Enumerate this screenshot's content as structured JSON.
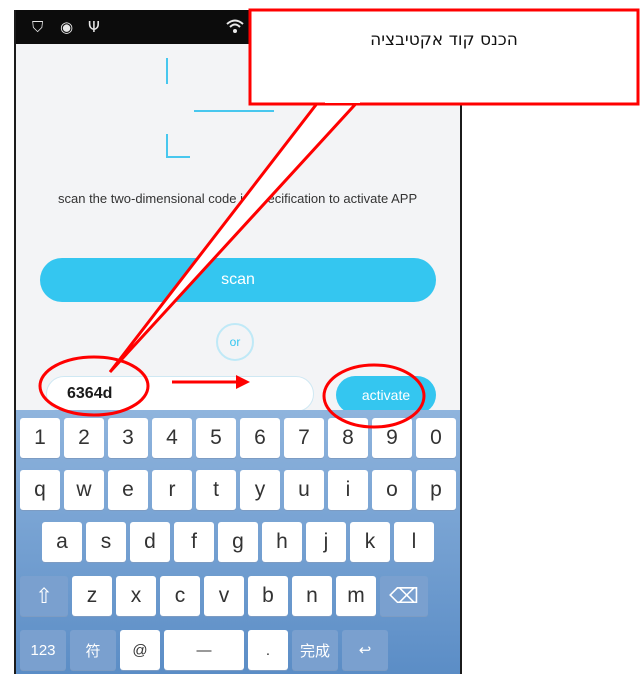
{
  "status_bar": {
    "icons": [
      "shield-icon",
      "circle-icon",
      "usb-icon",
      "wifi-icon"
    ]
  },
  "main": {
    "scan_hint": "scan the two-dimensional code in specification to activate APP",
    "scan_label": "scan",
    "or_label": "or",
    "code_value": "6364d",
    "activate_label": "activate"
  },
  "keyboard": {
    "row1": [
      "1",
      "2",
      "3",
      "4",
      "5",
      "6",
      "7",
      "8",
      "9",
      "0"
    ],
    "row2": [
      "q",
      "w",
      "e",
      "r",
      "t",
      "y",
      "u",
      "i",
      "o",
      "p"
    ],
    "row3": [
      "a",
      "s",
      "d",
      "f",
      "g",
      "h",
      "j",
      "k",
      "l"
    ],
    "row4": [
      "⇧",
      "z",
      "x",
      "c",
      "v",
      "b",
      "n",
      "m",
      "⌫"
    ],
    "row5": [
      "123",
      "符",
      "@",
      "—",
      ".",
      "完成",
      "↩"
    ]
  },
  "annotation": {
    "callout_text": "הכנס קוד אקטיבציה",
    "color": "#ff0000"
  }
}
